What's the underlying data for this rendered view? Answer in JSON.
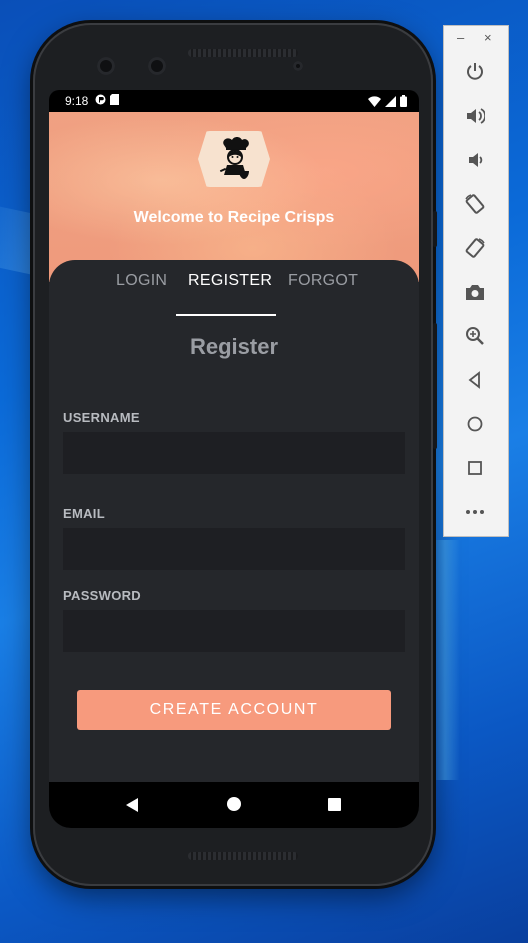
{
  "status_bar": {
    "time": "9:18"
  },
  "app": {
    "welcome": "Welcome to Recipe Crisps",
    "tabs": [
      {
        "label": "LOGIN",
        "active": false
      },
      {
        "label": "REGISTER",
        "active": true
      },
      {
        "label": "FORGOT",
        "active": false
      }
    ],
    "form_title": "Register",
    "fields": {
      "username": {
        "label": "USERNAME",
        "value": ""
      },
      "email": {
        "label": "EMAIL",
        "value": ""
      },
      "password": {
        "label": "PASSWORD",
        "value": ""
      }
    },
    "create_account_label": "CREATE ACCOUNT"
  },
  "emulator_toolbar": {
    "minimize": "–",
    "close": "×",
    "tools": [
      "power-icon",
      "volume-up-icon",
      "volume-down-icon",
      "rotate-left-icon",
      "rotate-right-icon",
      "camera-icon",
      "zoom-icon",
      "back-icon",
      "home-icon",
      "overview-icon",
      "more-icon"
    ]
  },
  "colors": {
    "accent": "#f79a7d",
    "card_bg": "#25272b",
    "input_bg": "#1e1f23",
    "desktop": "#0b6ad8"
  }
}
